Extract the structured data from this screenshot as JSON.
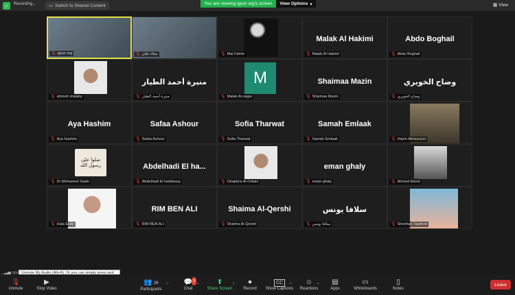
{
  "topbar": {
    "recording_label": "Recording...",
    "switch_label": "Switch to Shared Content",
    "banner": "You are viewing qpun org's screen",
    "view_options": "View Options",
    "view_label": "View"
  },
  "participants": [
    {
      "tile_name": "",
      "tag": "qpun org",
      "type": "video",
      "active": true
    },
    {
      "tile_name": "",
      "tag": "نجلاء علان",
      "type": "video"
    },
    {
      "tile_name": "",
      "tag": "Mai Fahim",
      "type": "dark-photo"
    },
    {
      "tile_name": "Malak Al Hakimi",
      "tag": "Malak Al Hakimi",
      "type": "name"
    },
    {
      "tile_name": "Abdo Boghail",
      "tag": "Abdo Boghail",
      "type": "name"
    },
    {
      "tile_name": "",
      "tag": "ahmed shalaby",
      "type": "photo-white"
    },
    {
      "tile_name": "منيرة أحمد الطيار",
      "tag": "منيرة أحمد الطيار",
      "type": "name"
    },
    {
      "tile_name": "M",
      "tag": "Malak Al-nagar",
      "type": "avatar"
    },
    {
      "tile_name": "Shaimaa Mazin",
      "tag": "Shaimaa Mazin",
      "type": "name"
    },
    {
      "tile_name": "وضاح الخويري",
      "tag": "وضاح الخويري",
      "type": "name"
    },
    {
      "tile_name": "Aya Hashim",
      "tag": "Aya Hashim",
      "type": "name"
    },
    {
      "tile_name": "Safaa Ashour",
      "tag": "Safaa Ashour",
      "type": "name"
    },
    {
      "tile_name": "Sofia Tharwat",
      "tag": "Sofia Tharwat",
      "type": "name"
    },
    {
      "tile_name": "Samah Emlaak",
      "tag": "Samah Emlaak",
      "type": "name"
    },
    {
      "tile_name": "",
      "tag": "Hazm Almazouni",
      "type": "photo-sepia"
    },
    {
      "tile_name": "صلوا على رسول الله",
      "tag": "Dr Mohamed Salah",
      "type": "sign"
    },
    {
      "tile_name": "Abdelhadi El ha...",
      "tag": "Abdelhadi El haddaouy",
      "type": "name"
    },
    {
      "tile_name": "",
      "tag": "Ghaida'a Al-Odaini",
      "type": "photo-white"
    },
    {
      "tile_name": "eman ghaly",
      "tag": "eman ghaly",
      "type": "name"
    },
    {
      "tile_name": "",
      "tag": "Ahmed Ebeid",
      "type": "photo-gray"
    },
    {
      "tile_name": "",
      "tag": "Hala Elafy",
      "type": "photo-white-large"
    },
    {
      "tile_name": "RIM BEN ALI",
      "tag": "RIM BEN ALI",
      "type": "name"
    },
    {
      "tile_name": "Shaima Al-Qershi",
      "tag": "Shaima Al-Qershi",
      "type": "name"
    },
    {
      "tile_name": "سلافا يونس",
      "tag": "سلافا يونس",
      "type": "name"
    },
    {
      "tile_name": "",
      "tag": "Sherihan Tawfeek",
      "type": "photo-sea"
    }
  ],
  "toolbar": {
    "unmute": "Unmute",
    "stop_video": "Stop Video",
    "participants": "Participants",
    "participants_count": "26",
    "chat": "Chat",
    "chat_badge": "3",
    "share_screen": "Share Screen",
    "record": "Record",
    "show_captions": "Show Captions",
    "reactions": "Reactions",
    "apps": "Apps",
    "whiteboards": "Whiteboards",
    "notes": "Notes",
    "leave": "Leave"
  },
  "tooltip": {
    "text": "Unmute My Audio (Alt+A). Or you can simply press and hold the space bar to temporarily unmute."
  },
  "signal_label": "qsun",
  "colors": {
    "accent_green": "#22b14c",
    "leave_red": "#cf2e2e",
    "active_speaker": "#e5e04a",
    "avatar_teal": "#1e8a6f"
  }
}
